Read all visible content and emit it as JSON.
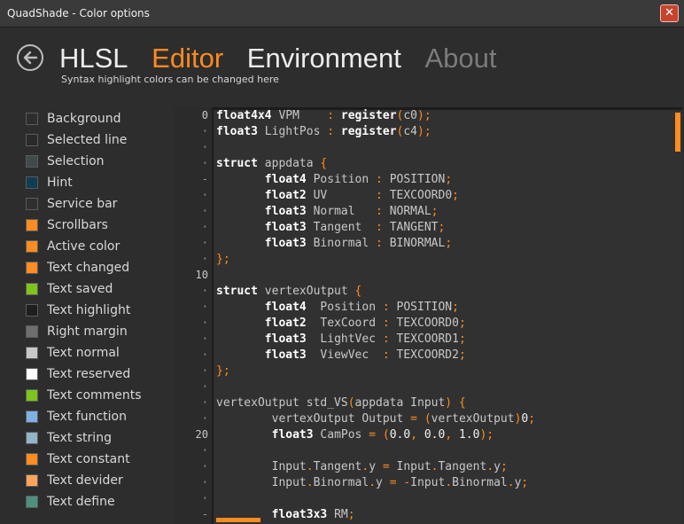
{
  "window": {
    "title": "QuadShade - Color options",
    "close_label": "✕"
  },
  "tabs": [
    {
      "label": "HLSL",
      "state": "normal"
    },
    {
      "label": "Editor",
      "state": "active"
    },
    {
      "label": "Environment",
      "state": "normal"
    },
    {
      "label": "About",
      "state": "dim"
    }
  ],
  "subtitle": "Syntax highlight colors can be changed here",
  "colors": [
    {
      "label": "Background",
      "color": "#2d2d2d"
    },
    {
      "label": "Selected line",
      "color": "#2a2a2a"
    },
    {
      "label": "Selection",
      "color": "#3f4a4d"
    },
    {
      "label": "Hint",
      "color": "#0f3d52"
    },
    {
      "label": "Service bar",
      "color": "#2f2f2f"
    },
    {
      "label": "Scrollbars",
      "color": "#ff8c1f"
    },
    {
      "label": "Active color",
      "color": "#ff8c1f"
    },
    {
      "label": "Text changed",
      "color": "#ff8c1f"
    },
    {
      "label": "Text saved",
      "color": "#7ec41a"
    },
    {
      "label": "Text highlight",
      "color": "#1e1e1e"
    },
    {
      "label": "Right margin",
      "color": "#6e6e6e"
    },
    {
      "label": "Text normal",
      "color": "#c8c8c8"
    },
    {
      "label": "Text reserved",
      "color": "#ffffff"
    },
    {
      "label": "Text comments",
      "color": "#7ec41a"
    },
    {
      "label": "Text function",
      "color": "#7fb1e6"
    },
    {
      "label": "Text string",
      "color": "#92b5c7"
    },
    {
      "label": "Text constant",
      "color": "#ff8c1f"
    },
    {
      "label": "Text devider",
      "color": "#ffa45a"
    },
    {
      "label": "Text define",
      "color": "#4f8f7f"
    }
  ],
  "line_numbers": [
    "0",
    "·",
    "·",
    "·",
    "-",
    "·",
    "·",
    "·",
    "·",
    "·",
    "10",
    "·",
    "·",
    "·",
    "·",
    "·",
    "·",
    "·",
    "·",
    "·",
    "20",
    "·",
    "·",
    "·",
    "·",
    "-"
  ],
  "code": [
    [
      [
        "kw",
        "float4x4"
      ],
      [
        "id",
        " VPM    "
      ],
      [
        "op",
        ":"
      ],
      [
        "id",
        " "
      ],
      [
        "kw",
        "register"
      ],
      [
        "op",
        "("
      ],
      [
        "id",
        "c0"
      ],
      [
        "op",
        ")"
      ],
      [
        "op",
        ";"
      ]
    ],
    [
      [
        "kw",
        "float3"
      ],
      [
        "id",
        " LightPos "
      ],
      [
        "op",
        ":"
      ],
      [
        "id",
        " "
      ],
      [
        "kw",
        "register"
      ],
      [
        "op",
        "("
      ],
      [
        "id",
        "c4"
      ],
      [
        "op",
        ")"
      ],
      [
        "op",
        ";"
      ]
    ],
    [],
    [
      [
        "kw",
        "struct"
      ],
      [
        "id",
        " appdata "
      ],
      [
        "op",
        "{"
      ]
    ],
    [
      [
        "id",
        "       "
      ],
      [
        "kw",
        "float4"
      ],
      [
        "id",
        " Position "
      ],
      [
        "op",
        ":"
      ],
      [
        "id",
        " POSITION"
      ],
      [
        "op",
        ";"
      ]
    ],
    [
      [
        "id",
        "       "
      ],
      [
        "kw",
        "float2"
      ],
      [
        "id",
        " UV       "
      ],
      [
        "op",
        ":"
      ],
      [
        "id",
        " TEXCOORD0"
      ],
      [
        "op",
        ";"
      ]
    ],
    [
      [
        "id",
        "       "
      ],
      [
        "kw",
        "float3"
      ],
      [
        "id",
        " Normal   "
      ],
      [
        "op",
        ":"
      ],
      [
        "id",
        " NORMAL"
      ],
      [
        "op",
        ";"
      ]
    ],
    [
      [
        "id",
        "       "
      ],
      [
        "kw",
        "float3"
      ],
      [
        "id",
        " Tangent  "
      ],
      [
        "op",
        ":"
      ],
      [
        "id",
        " TANGENT"
      ],
      [
        "op",
        ";"
      ]
    ],
    [
      [
        "id",
        "       "
      ],
      [
        "kw",
        "float3"
      ],
      [
        "id",
        " Binormal "
      ],
      [
        "op",
        ":"
      ],
      [
        "id",
        " BINORMAL"
      ],
      [
        "op",
        ";"
      ]
    ],
    [
      [
        "op",
        "};"
      ]
    ],
    [],
    [
      [
        "kw",
        "struct"
      ],
      [
        "id",
        " vertexOutput "
      ],
      [
        "op",
        "{"
      ]
    ],
    [
      [
        "id",
        "       "
      ],
      [
        "kw",
        "float4"
      ],
      [
        "id",
        "  Position "
      ],
      [
        "op",
        ":"
      ],
      [
        "id",
        " POSITION"
      ],
      [
        "op",
        ";"
      ]
    ],
    [
      [
        "id",
        "       "
      ],
      [
        "kw",
        "float2"
      ],
      [
        "id",
        "  TexCoord "
      ],
      [
        "op",
        ":"
      ],
      [
        "id",
        " TEXCOORD0"
      ],
      [
        "op",
        ";"
      ]
    ],
    [
      [
        "id",
        "       "
      ],
      [
        "kw",
        "float3"
      ],
      [
        "id",
        "  LightVec "
      ],
      [
        "op",
        ":"
      ],
      [
        "id",
        " TEXCOORD1"
      ],
      [
        "op",
        ";"
      ]
    ],
    [
      [
        "id",
        "       "
      ],
      [
        "kw",
        "float3"
      ],
      [
        "id",
        "  ViewVec  "
      ],
      [
        "op",
        ":"
      ],
      [
        "id",
        " TEXCOORD2"
      ],
      [
        "op",
        ";"
      ]
    ],
    [
      [
        "op",
        "};"
      ]
    ],
    [],
    [
      [
        "id",
        "vertexOutput std_VS"
      ],
      [
        "op",
        "("
      ],
      [
        "id",
        "appdata Input"
      ],
      [
        "op",
        ")"
      ],
      [
        "id",
        " "
      ],
      [
        "op",
        "{"
      ]
    ],
    [
      [
        "id",
        "        vertexOutput Output "
      ],
      [
        "op",
        "="
      ],
      [
        "id",
        " "
      ],
      [
        "op",
        "("
      ],
      [
        "id",
        "vertexOutput"
      ],
      [
        "op",
        ")"
      ],
      [
        "cn",
        "0"
      ],
      [
        "op",
        ";"
      ]
    ],
    [
      [
        "id",
        "        "
      ],
      [
        "kw",
        "float3"
      ],
      [
        "id",
        " CamPos "
      ],
      [
        "op",
        "="
      ],
      [
        "id",
        " "
      ],
      [
        "op",
        "("
      ],
      [
        "cn",
        "0.0"
      ],
      [
        "op",
        ","
      ],
      [
        "id",
        " "
      ],
      [
        "cn",
        "0.0"
      ],
      [
        "op",
        ","
      ],
      [
        "id",
        " "
      ],
      [
        "cn",
        "1.0"
      ],
      [
        "op",
        ")"
      ],
      [
        "op",
        ";"
      ]
    ],
    [],
    [
      [
        "id",
        "        Input"
      ],
      [
        "op",
        "."
      ],
      [
        "id",
        "Tangent"
      ],
      [
        "op",
        "."
      ],
      [
        "id",
        "y "
      ],
      [
        "op",
        "="
      ],
      [
        "id",
        " Input"
      ],
      [
        "op",
        "."
      ],
      [
        "id",
        "Tangent"
      ],
      [
        "op",
        "."
      ],
      [
        "id",
        "y"
      ],
      [
        "op",
        ";"
      ]
    ],
    [
      [
        "id",
        "        Input"
      ],
      [
        "op",
        "."
      ],
      [
        "id",
        "Binormal"
      ],
      [
        "op",
        "."
      ],
      [
        "id",
        "y "
      ],
      [
        "op",
        "="
      ],
      [
        "id",
        " "
      ],
      [
        "op",
        "-"
      ],
      [
        "id",
        "Input"
      ],
      [
        "op",
        "."
      ],
      [
        "id",
        "Binormal"
      ],
      [
        "op",
        "."
      ],
      [
        "id",
        "y"
      ],
      [
        "op",
        ";"
      ]
    ],
    [],
    [
      [
        "id",
        "        "
      ],
      [
        "kw",
        "float3x3"
      ],
      [
        "id",
        " RM"
      ],
      [
        "op",
        ";"
      ]
    ]
  ]
}
